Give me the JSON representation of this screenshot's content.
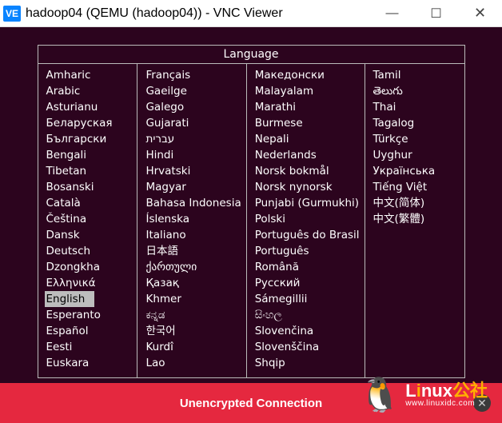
{
  "window": {
    "title": "hadoop04 (QEMU (hadoop04)) - VNC Viewer",
    "icon_label": "VE",
    "min": "—",
    "max": "☐",
    "close": "✕"
  },
  "language_panel": {
    "header": "Language",
    "selected": "English",
    "columns": [
      [
        "Amharic",
        "Arabic",
        "Asturianu",
        "Беларуская",
        "Български",
        "Bengali",
        "Tibetan",
        "Bosanski",
        "Català",
        "Čeština",
        "Dansk",
        "Deutsch",
        "Dzongkha",
        "Ελληνικά",
        "English",
        "Esperanto",
        "Español",
        "Eesti",
        "Euskara"
      ],
      [
        "Français",
        "Gaeilge",
        "Galego",
        "Gujarati",
        "עברית",
        "Hindi",
        "Hrvatski",
        "Magyar",
        "Bahasa Indonesia",
        "Íslenska",
        "Italiano",
        "日本語",
        "ქართული",
        "Қазақ",
        "Khmer",
        "ಕನ್ನಡ",
        "한국어",
        "Kurdî",
        "Lao"
      ],
      [
        "Македонски",
        "Malayalam",
        "Marathi",
        "Burmese",
        "Nepali",
        "Nederlands",
        "Norsk bokmål",
        "Norsk nynorsk",
        "Punjabi (Gurmukhi)",
        "Polski",
        "Português do Brasil",
        "Português",
        "Română",
        "Русский",
        "Sámegillii",
        "සිංහල",
        "Slovenčina",
        "Slovenščina",
        "Shqip"
      ],
      [
        "Tamil",
        "తెలుగు",
        "Thai",
        "Tagalog",
        "Türkçe",
        "Uyghur",
        "Українська",
        "Tiếng Việt",
        "中文(简体)",
        "中文(繁體)"
      ]
    ]
  },
  "footer": {
    "message": "Unencrypted Connection",
    "close": "✕"
  },
  "watermark": {
    "site_prefix": "L",
    "site_i": "i",
    "site_suffix": "nux",
    "sub": "www.linuxidc.com"
  }
}
